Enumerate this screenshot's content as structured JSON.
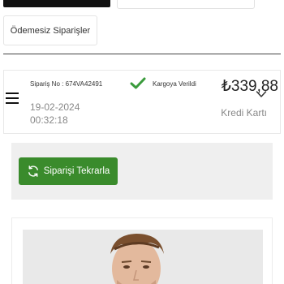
{
  "tabs": {
    "active_color": "#111111"
  },
  "filters": {
    "unpaid_label": "Ödemesiz Siparişler"
  },
  "order": {
    "order_no": "Sipariş No : 674VA42491",
    "status": "Kargoya Verildi",
    "status_color": "#3a9b3c",
    "price": "₺339,88",
    "date": "19-02-2024",
    "time": "00:32:18",
    "payment_method": "Kredi Kartı"
  },
  "actions": {
    "reorder_label": "Siparişi Tekrarla",
    "reorder_color": "#3a8b2c"
  },
  "icons": {
    "menu": "menu-icon",
    "status": "check-icon",
    "expand": "chevron-down-icon",
    "reorder": "refresh-icon"
  },
  "product": {
    "image": "product-image"
  }
}
